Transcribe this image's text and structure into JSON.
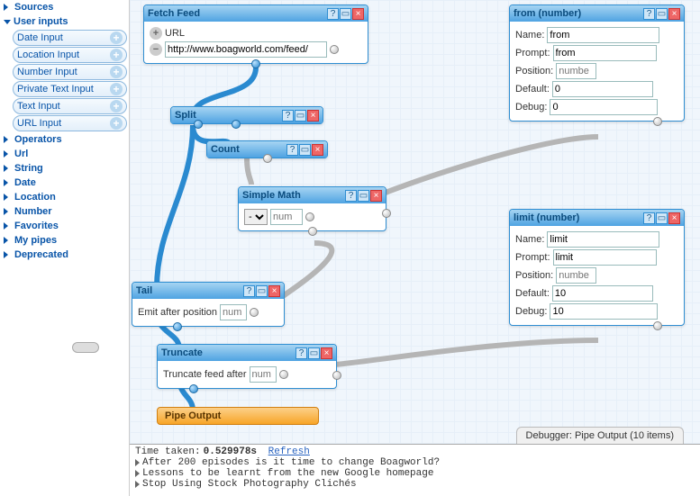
{
  "sidebar": {
    "sections": [
      {
        "label": "Sources",
        "open": false
      },
      {
        "label": "User inputs",
        "open": true,
        "items": [
          {
            "label": "Date Input"
          },
          {
            "label": "Location Input"
          },
          {
            "label": "Number Input"
          },
          {
            "label": "Private Text Input"
          },
          {
            "label": "Text Input"
          },
          {
            "label": "URL Input"
          }
        ]
      },
      {
        "label": "Operators",
        "open": false
      },
      {
        "label": "Url",
        "open": false
      },
      {
        "label": "String",
        "open": false
      },
      {
        "label": "Date",
        "open": false
      },
      {
        "label": "Location",
        "open": false
      },
      {
        "label": "Number",
        "open": false
      },
      {
        "label": "Favorites",
        "open": false
      },
      {
        "label": "My pipes",
        "open": false
      },
      {
        "label": "Deprecated",
        "open": false
      }
    ]
  },
  "nodes": {
    "fetch_feed": {
      "title": "Fetch Feed",
      "add_label": "URL",
      "url_value": "http://www.boagworld.com/feed/"
    },
    "split": {
      "title": "Split"
    },
    "count": {
      "title": "Count"
    },
    "simple_math": {
      "title": "Simple Math",
      "op": "-",
      "rhs_placeholder": "num"
    },
    "tail": {
      "title": "Tail",
      "label": "Emit after position",
      "value_placeholder": "num"
    },
    "truncate": {
      "title": "Truncate",
      "label": "Truncate feed after",
      "value_placeholder": "num"
    },
    "from": {
      "title": "from (number)",
      "name_label": "Name:",
      "name_value": "from",
      "prompt_label": "Prompt:",
      "prompt_value": "from",
      "position_label": "Position:",
      "position_placeholder": "numbe",
      "default_label": "Default:",
      "default_value": "0",
      "debug_label": "Debug:",
      "debug_value": "0"
    },
    "limit": {
      "title": "limit (number)",
      "name_label": "Name:",
      "name_value": "limit",
      "prompt_label": "Prompt:",
      "prompt_value": "limit",
      "position_label": "Position:",
      "position_placeholder": "numbe",
      "default_label": "Default:",
      "default_value": "10",
      "debug_label": "Debug:",
      "debug_value": "10"
    },
    "pipe_output": {
      "title": "Pipe Output"
    }
  },
  "debugger_tab": "Debugger: Pipe Output (10 items)",
  "console": {
    "time_label": "Time taken:",
    "time_value": "0.529978s",
    "refresh": "Refresh",
    "items": [
      "After 200 episodes is it time to change Boagworld?",
      "Lessons to be learnt from the new Google homepage",
      "Stop Using Stock Photography Clichés"
    ]
  }
}
